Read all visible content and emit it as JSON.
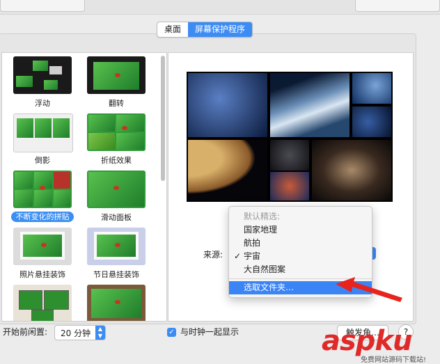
{
  "segmented": {
    "tabs": [
      {
        "label": "桌面"
      },
      {
        "label": "屏幕保护程序"
      }
    ],
    "selected_index": 1
  },
  "screensavers": [
    {
      "label": "浮动"
    },
    {
      "label": "翻转"
    },
    {
      "label": "倒影"
    },
    {
      "label": "折纸效果"
    },
    {
      "label": "不断变化的拼贴",
      "selected": true
    },
    {
      "label": "滑动面板"
    },
    {
      "label": "照片悬挂装饰"
    },
    {
      "label": "节日悬挂装饰"
    },
    {
      "label": ""
    },
    {
      "label": ""
    }
  ],
  "source": {
    "label": "来源:"
  },
  "menu": {
    "header": "默认精选:",
    "items": [
      "国家地理",
      "航拍",
      "宇宙",
      "大自然图案"
    ],
    "checked_item": "宇宙",
    "action": "选取文件夹…"
  },
  "bottom": {
    "idle_label": "开始前闲置:",
    "idle_value": "20 分钟",
    "clock_label": "与时钟一起显示",
    "clock_checked": true,
    "hot_corners_label": "触发角…",
    "help_label": "?"
  },
  "watermark": {
    "brand": "aspku",
    "tagline": "免费网站源码下载站!"
  },
  "colors": {
    "accent": "#3c8cf4",
    "annotation_arrow": "#e8231d"
  }
}
